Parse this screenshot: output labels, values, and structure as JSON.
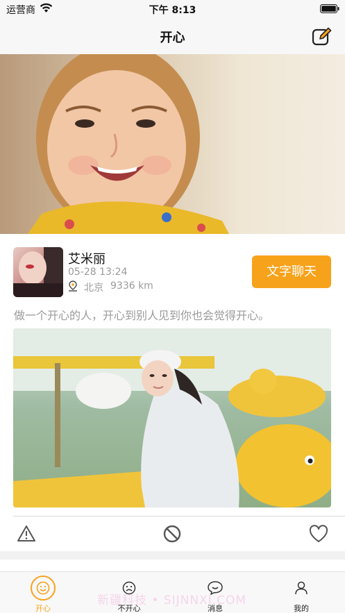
{
  "status_bar": {
    "carrier": "运营商",
    "time": "下午 8:13"
  },
  "nav": {
    "title": "开心"
  },
  "post": {
    "username": "艾米丽",
    "time": "05-28 13:24",
    "city": "北京",
    "distance": "9336 km",
    "chat_label": "文字聊天",
    "text": "做一个开心的人，开心到别人见到你也会觉得开心。"
  },
  "tabs": [
    {
      "label": "开心",
      "icon": "smile-icon",
      "active": true
    },
    {
      "label": "不开心",
      "icon": "sad-icon",
      "active": false
    },
    {
      "label": "消息",
      "icon": "message-icon",
      "active": false
    },
    {
      "label": "我的",
      "icon": "profile-icon",
      "active": false
    }
  ],
  "watermark": "新疆科技 • SIJNNXI.COM",
  "colors": {
    "accent": "#f7a21b",
    "secondary_text": "#9a9a9a"
  }
}
